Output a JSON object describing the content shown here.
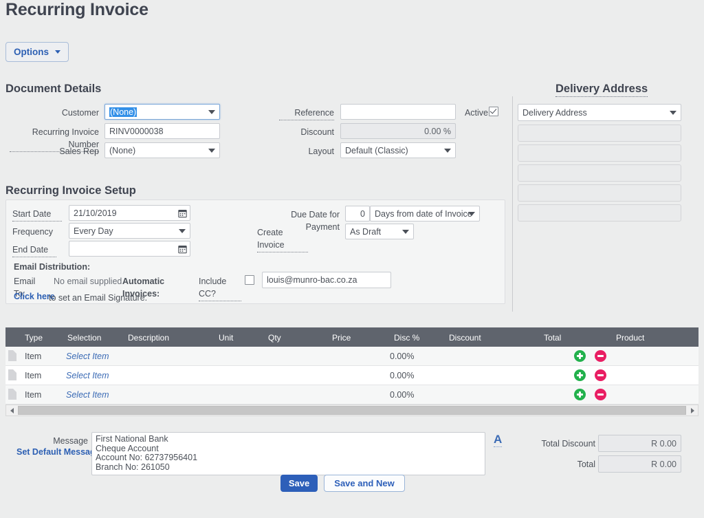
{
  "page": {
    "title": "Recurring Invoice"
  },
  "toolbar": {
    "options_label": "Options"
  },
  "document_details": {
    "heading": "Document Details",
    "customer_label": "Customer",
    "customer_value": "(None)",
    "recurring_invoice_number_label": "Recurring Invoice Number",
    "recurring_invoice_number_value": "RINV0000038",
    "sales_rep_label": "Sales Rep",
    "sales_rep_value": "(None)",
    "reference_label": "Reference",
    "reference_value": "",
    "discount_label": "Discount",
    "discount_value": "0.00 %",
    "layout_label": "Layout",
    "layout_value": "Default (Classic)",
    "active_label": "Active",
    "active_checked": true
  },
  "delivery_address": {
    "heading": "Delivery Address",
    "select_value": "Delivery Address",
    "lines": [
      "",
      "",
      "",
      "",
      ""
    ]
  },
  "setup": {
    "heading": "Recurring Invoice Setup",
    "start_date_label": "Start Date",
    "start_date_value": "21/10/2019",
    "frequency_label": "Frequency",
    "frequency_value": "Every Day",
    "end_date_label": "End Date",
    "end_date_value": "",
    "due_date_label": "Due Date for Payment",
    "due_date_days": "0",
    "due_date_basis": "Days from date of Invoice",
    "create_invoice_label": "Create Invoice",
    "create_invoice_value": "As Draft",
    "email_distribution_label": "Email Distribution:",
    "email_to_label": "Email To:",
    "email_to_value": "No email supplied.",
    "automatic_invoices_label": "Automatic Invoices:",
    "include_cc_label": "Include CC?",
    "include_cc_checked": false,
    "cc_email_value": "louis@munro-bac.co.za",
    "signature_link": "Click here",
    "signature_text": " to set an Email Signature."
  },
  "line_items": {
    "columns": [
      "Type",
      "Selection",
      "Description",
      "Unit",
      "Qty",
      "Price",
      "Disc %",
      "Discount",
      "Total",
      "Product"
    ],
    "rows": [
      {
        "type": "Item",
        "selection": "Select Item",
        "description": "",
        "unit": "",
        "qty": "",
        "price": "",
        "disc_pct": "0.00%",
        "discount": "",
        "total": "",
        "product": ""
      },
      {
        "type": "Item",
        "selection": "Select Item",
        "description": "",
        "unit": "",
        "qty": "",
        "price": "",
        "disc_pct": "0.00%",
        "discount": "",
        "total": "",
        "product": ""
      },
      {
        "type": "Item",
        "selection": "Select Item",
        "description": "",
        "unit": "",
        "qty": "",
        "price": "",
        "disc_pct": "0.00%",
        "discount": "",
        "total": "",
        "product": ""
      }
    ]
  },
  "footer": {
    "message_label": "Message",
    "set_default_message_link": "Set Default Message",
    "message_value": "First National Bank\nCheque Account\nAccount No: 62737956401\nBranch No: 261050",
    "font_icon_label": "A",
    "total_discount_label": "Total Discount",
    "total_discount_value": "R 0.00",
    "total_label": "Total",
    "total_value": "R 0.00",
    "save_label": "Save",
    "save_and_new_label": "Save and New"
  },
  "colors": {
    "accent_blue": "#2d5fb9",
    "link_blue": "#2c5fb3",
    "header_grey": "#5f646d",
    "page_bg": "#eceded",
    "add_green": "#22b14c",
    "remove_pink": "#e91e63",
    "selection_blue": "#3390e8"
  }
}
